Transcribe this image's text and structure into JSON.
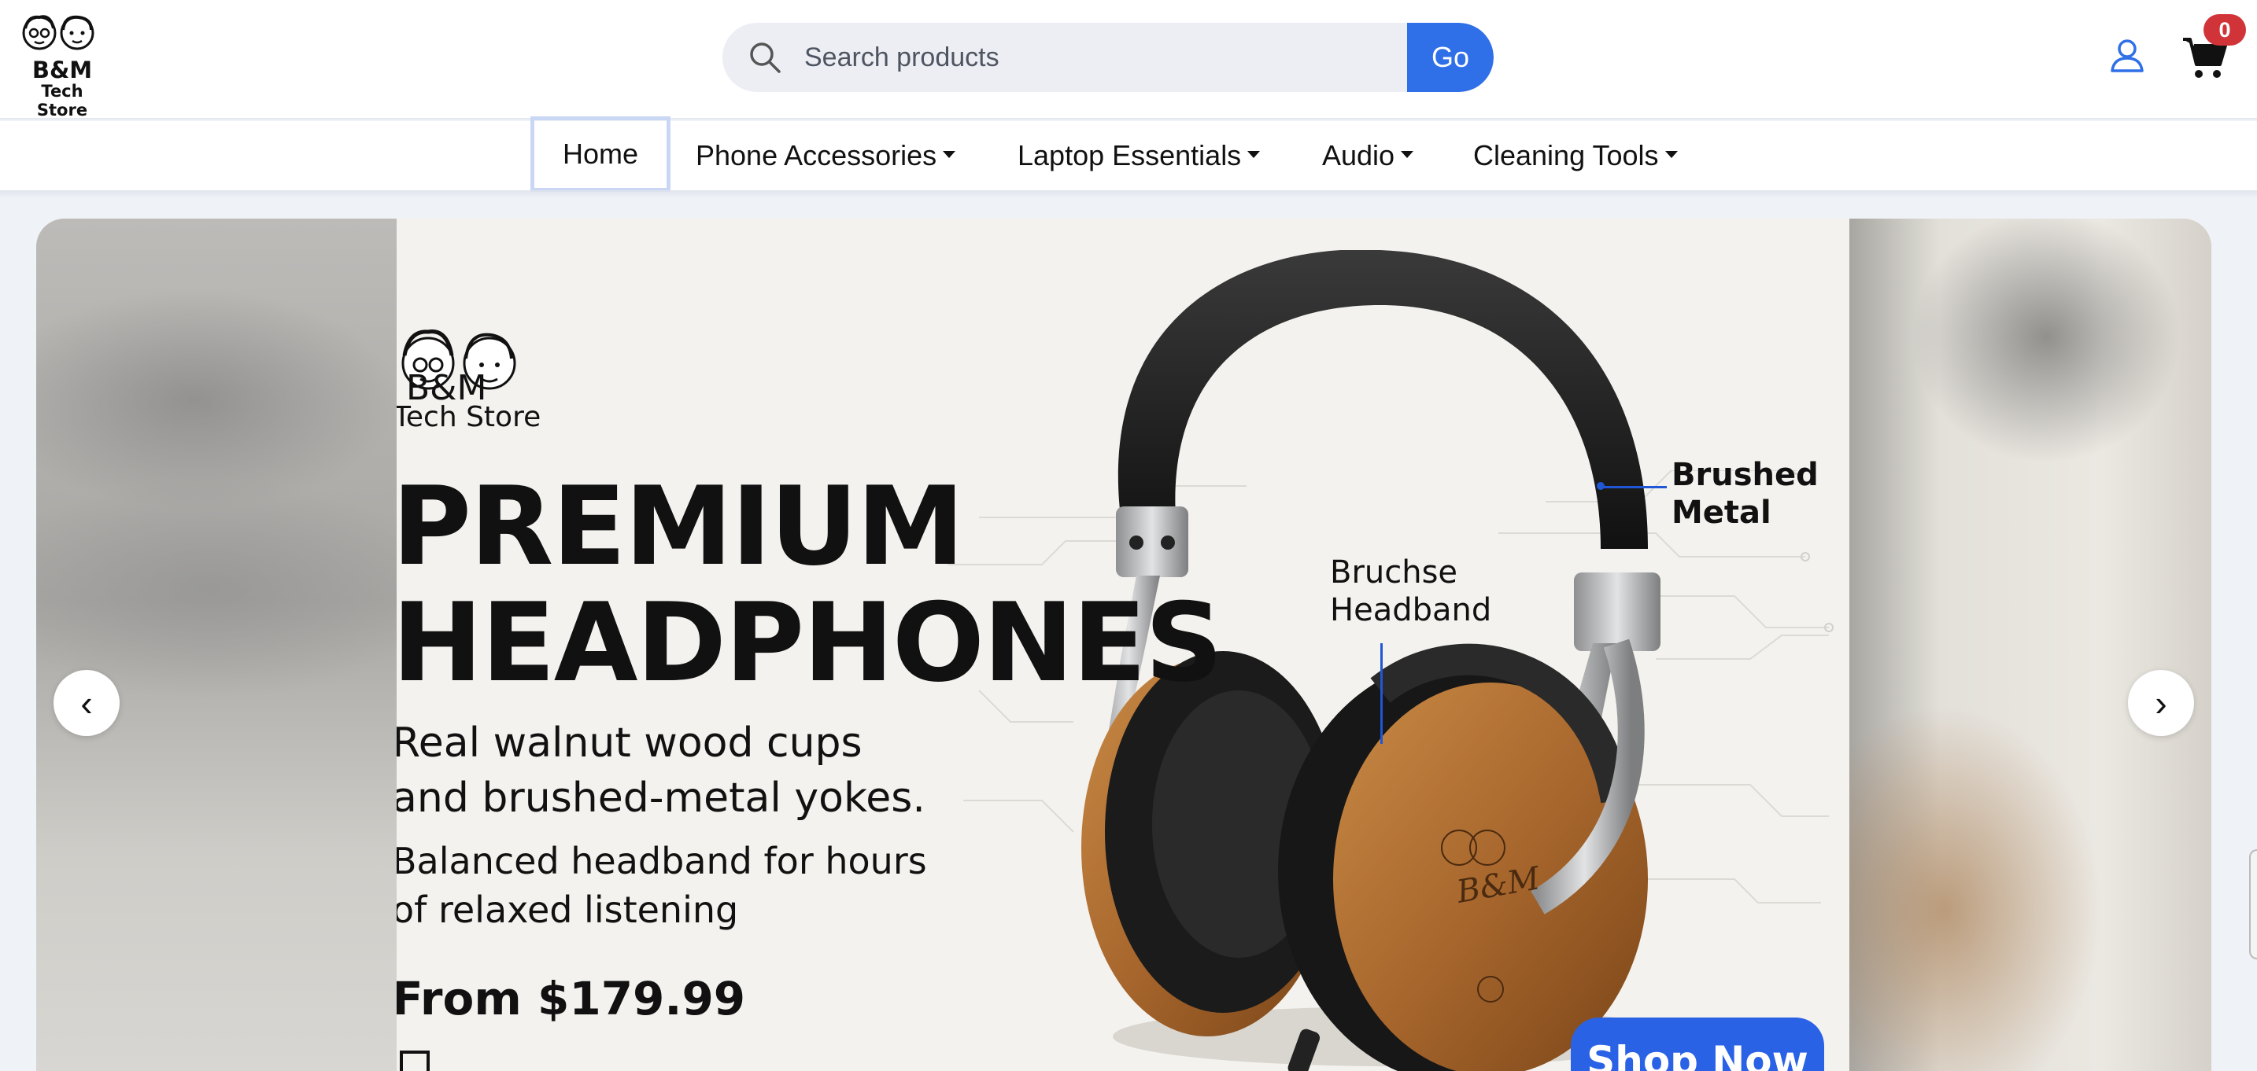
{
  "store": {
    "logo_line1": "B&M",
    "logo_line2": "Tech Store"
  },
  "search": {
    "placeholder": "Search products",
    "value": "",
    "button_label": "Go"
  },
  "header_icons": {
    "user": "user-icon",
    "cart": "cart-icon",
    "cart_count": "0"
  },
  "nav": {
    "items": [
      {
        "label": "Home",
        "active": true,
        "dropdown": false
      },
      {
        "label": "Phone Accessories",
        "active": false,
        "dropdown": true
      },
      {
        "label": "Laptop Essentials",
        "active": false,
        "dropdown": true
      },
      {
        "label": "Audio",
        "active": false,
        "dropdown": true
      },
      {
        "label": "Cleaning Tools",
        "active": false,
        "dropdown": true
      }
    ]
  },
  "carousel": {
    "prev_label": "‹",
    "next_label": "›",
    "slide": {
      "logo_line1": "B&M",
      "logo_line2": "Tech Store",
      "title_line1": "PREMIUM",
      "title_line2": "HEADPHONES",
      "subtitle": "Real walnut wood cups and brushed-metal yokes.",
      "description": "Balanced headband for hours of relaxed listening",
      "price": "From $179.99",
      "callout_metal": "Brushed Metal",
      "callout_headband": "Bruchse Headband",
      "cup_logo": "B&M",
      "cta": "Shop Now"
    }
  },
  "colors": {
    "accent": "#2f6fe8",
    "badge": "#d13438",
    "page_bg": "#eff2f7"
  }
}
